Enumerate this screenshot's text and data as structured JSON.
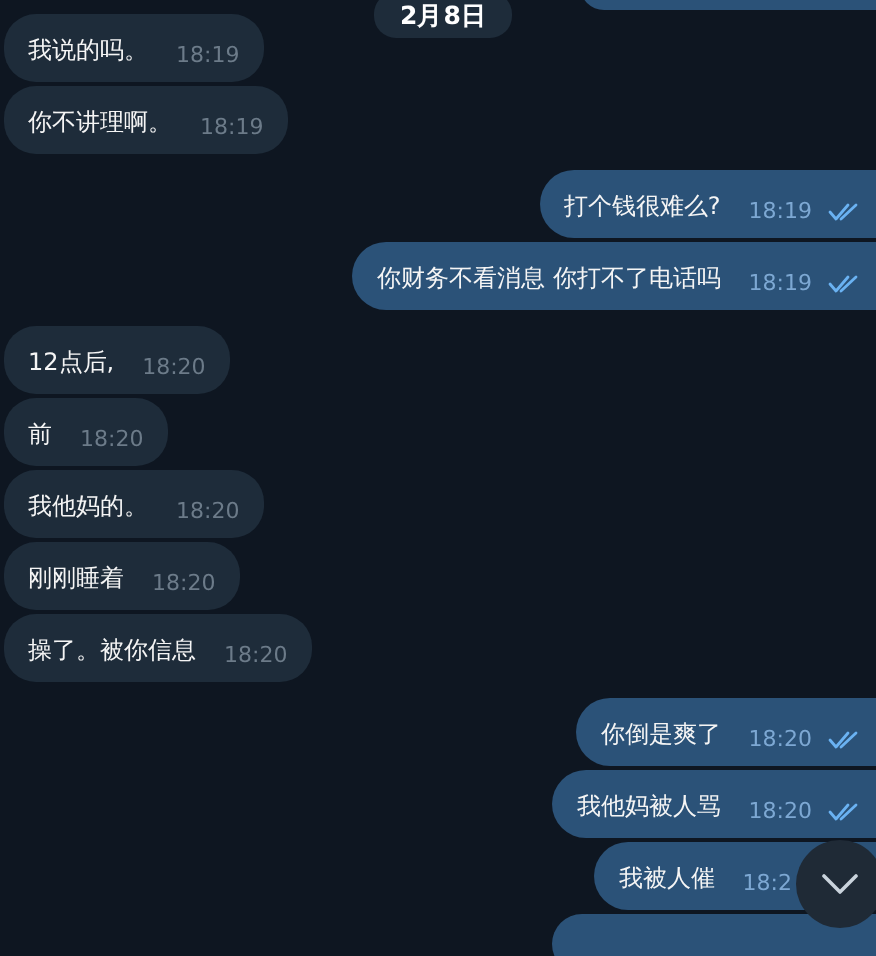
{
  "date_badge": "2月8日",
  "messages": [
    {
      "kind": "outgoing"
    },
    {
      "kind": "incoming",
      "text": "我说的吗。",
      "time": "18:19"
    },
    {
      "kind": "incoming",
      "text": "你不讲理啊。",
      "time": "18:19"
    },
    {
      "kind": "outgoing",
      "text": "打个钱很难么?",
      "time": "18:19",
      "read": true
    },
    {
      "kind": "outgoing",
      "text": "你财务不看消息 你打不了电话吗",
      "time": "18:19",
      "read": true
    },
    {
      "kind": "incoming",
      "text": "12点后,",
      "time": "18:20"
    },
    {
      "kind": "incoming",
      "text": "前",
      "time": "18:20"
    },
    {
      "kind": "incoming",
      "text": "我他妈的。",
      "time": "18:20"
    },
    {
      "kind": "incoming",
      "text": "刚刚睡着",
      "time": "18:20"
    },
    {
      "kind": "incoming",
      "text": "操了。被你信息",
      "time": "18:20"
    },
    {
      "kind": "outgoing",
      "text": "你倒是爽了",
      "time": "18:20",
      "read": true
    },
    {
      "kind": "outgoing",
      "text": "我他妈被人骂",
      "time": "18:20",
      "read": true
    },
    {
      "kind": "outgoing",
      "text": "我被人催",
      "time": "18:2"
    },
    {
      "kind": "outgoing"
    }
  ]
}
